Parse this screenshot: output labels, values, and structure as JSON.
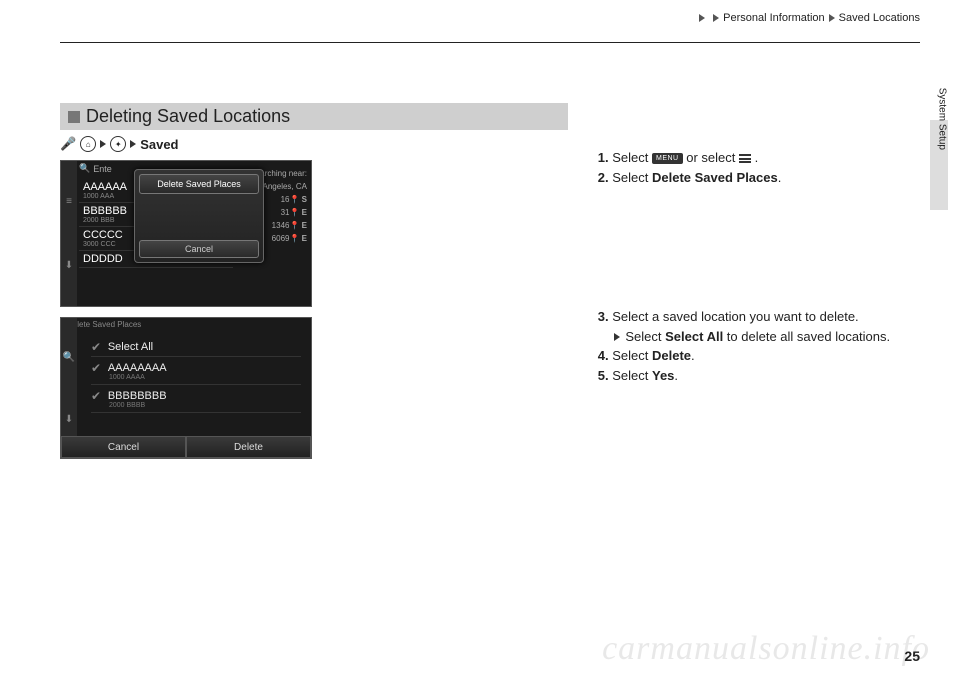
{
  "header": {
    "crumb1": "Personal Information",
    "crumb2": "Saved Locations"
  },
  "side_tab": "System Setup",
  "section_title": "Deleting Saved Locations",
  "navpath_saved": "Saved",
  "screenshot1": {
    "search_label": "Ente",
    "searching_near": "Searching near:",
    "searching_loc": "Los Angeles, CA",
    "rows": [
      {
        "main": "AAAAAA",
        "sub": "1000 AAA",
        "dist": "16",
        "dir": "S"
      },
      {
        "main": "BBBBBB",
        "sub": "2000 BBB",
        "dist": "31",
        "dir": "E"
      },
      {
        "main": "CCCCC",
        "sub": "3000 CCC",
        "dist": "1346",
        "dir": "E"
      },
      {
        "main": "DDDDD",
        "sub": "",
        "dist": "6069",
        "dir": "E"
      }
    ],
    "dialog_option": "Delete Saved Places",
    "dialog_cancel": "Cancel"
  },
  "screenshot2": {
    "title": "Delete Saved Places",
    "rows": [
      {
        "main": "Select All",
        "sub": ""
      },
      {
        "main": "AAAAAAAA",
        "sub": "1000 AAAA"
      },
      {
        "main": "BBBBBBBB",
        "sub": "2000 BBBB"
      }
    ],
    "cancel": "Cancel",
    "delete": "Delete"
  },
  "steps": {
    "s1a": "Select ",
    "s1b": " or select ",
    "s1c": ".",
    "menu_badge": "MENU",
    "s2a": "Select ",
    "s2b": "Delete Saved Places",
    "s2c": ".",
    "s3": "Select a saved location you want to delete.",
    "s3sub_a": "Select ",
    "s3sub_b": "Select All",
    "s3sub_c": " to delete all saved locations.",
    "s4a": "Select ",
    "s4b": "Delete",
    "s4c": ".",
    "s5a": "Select ",
    "s5b": "Yes",
    "s5c": "."
  },
  "page_number": "25",
  "watermark": "carmanualsonline.info"
}
